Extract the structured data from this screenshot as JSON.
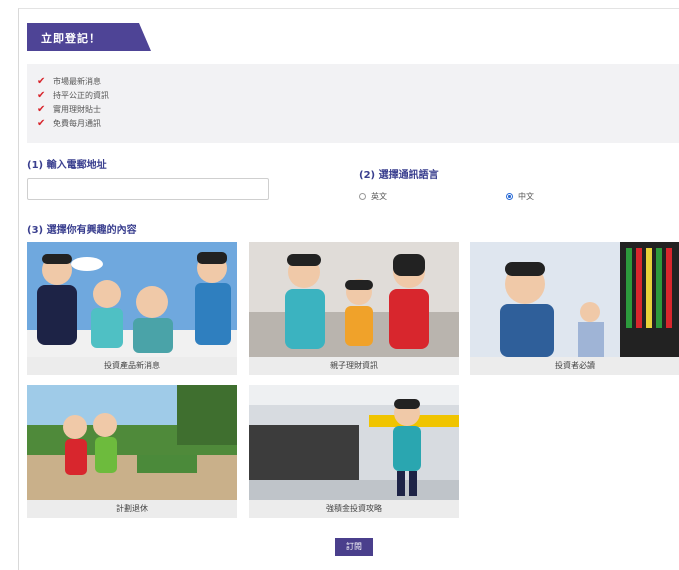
{
  "banner": {
    "title": "立即登記！",
    "color": "#4e4496"
  },
  "benefits": [
    "市場最新消息",
    "持平公正的資訊",
    "實用理財貼士",
    "免費每月通訊"
  ],
  "email": {
    "label": "(1) 輸入電郵地址",
    "value": ""
  },
  "language": {
    "label": "(2) 選擇通訊語言",
    "options": [
      {
        "label": "英文",
        "selected": false
      },
      {
        "label": "中文",
        "selected": true
      }
    ]
  },
  "interests": {
    "label": "(3) 選擇你有興趣的內容",
    "cards": [
      {
        "caption": "投資產品新消息",
        "icon": "people-group-illustration"
      },
      {
        "caption": "親子理財資訊",
        "icon": "family-illustration"
      },
      {
        "caption": "投資者必讀",
        "icon": "investor-thinking-illustration"
      },
      {
        "caption": "計劃退休",
        "icon": "retirement-couple-illustration"
      },
      {
        "caption": "強積金投資攻略",
        "icon": "office-worker-illustration"
      }
    ]
  },
  "submit_label": "訂閱",
  "colors": {
    "accent": "#4e4496",
    "check": "#d8262d",
    "heading": "#3a3f8f"
  }
}
